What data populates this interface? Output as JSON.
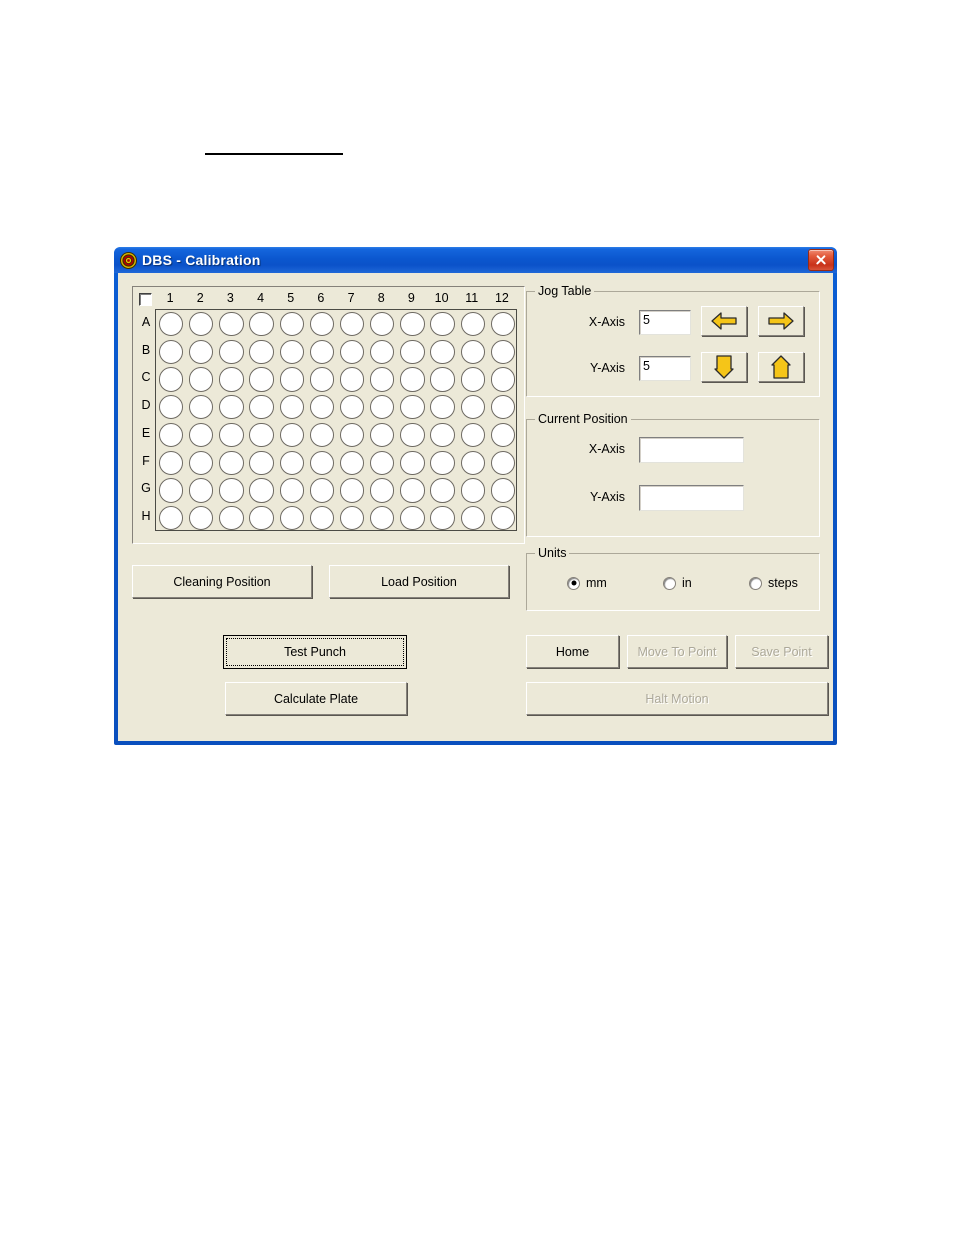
{
  "window": {
    "title": "DBS  -  Calibration",
    "icon": "target-icon",
    "close_label": "Close",
    "accent_color": "#0b57cf",
    "client_color": "#ece9d8"
  },
  "plate": {
    "select_all_checked": false,
    "columns": [
      "1",
      "2",
      "3",
      "4",
      "5",
      "6",
      "7",
      "8",
      "9",
      "10",
      "11",
      "12"
    ],
    "rows": [
      "A",
      "B",
      "C",
      "D",
      "E",
      "F",
      "G",
      "H"
    ],
    "well_color": "#ffffff"
  },
  "plate_buttons": [
    {
      "name": "cleaning-position-button",
      "label": "Cleaning Position",
      "enabled": true,
      "focused": false
    },
    {
      "name": "load-position-button",
      "label": "Load Position",
      "enabled": true,
      "focused": false
    },
    {
      "name": "test-punch-button",
      "label": "Test Punch",
      "enabled": true,
      "focused": true
    },
    {
      "name": "calculate-plate-button",
      "label": "Calculate Plate",
      "enabled": true,
      "focused": false
    }
  ],
  "jog_table": {
    "legend": "Jog Table",
    "x_label": "X-Axis",
    "x_value": "5",
    "y_label": "Y-Axis",
    "y_value": "5",
    "arrow_color": "#f5c518",
    "buttons": [
      {
        "name": "jog-left-button",
        "direction": "left"
      },
      {
        "name": "jog-right-button",
        "direction": "right"
      },
      {
        "name": "jog-down-button",
        "direction": "down"
      },
      {
        "name": "jog-up-button",
        "direction": "up"
      }
    ]
  },
  "current_position": {
    "legend": "Current Position",
    "x_label": "X-Axis",
    "x_value": "",
    "y_label": "Y-Axis",
    "y_value": ""
  },
  "units": {
    "legend": "Units",
    "options": [
      {
        "label": "mm",
        "selected": true
      },
      {
        "label": "in",
        "selected": false
      },
      {
        "label": "steps",
        "selected": false
      }
    ]
  },
  "motion_buttons": [
    {
      "name": "home-button",
      "label": "Home",
      "enabled": true
    },
    {
      "name": "move-to-point-button",
      "label": "Move To Point",
      "enabled": false
    },
    {
      "name": "save-point-button",
      "label": "Save Point",
      "enabled": false
    },
    {
      "name": "halt-motion-button",
      "label": "Halt Motion",
      "enabled": false
    }
  ]
}
